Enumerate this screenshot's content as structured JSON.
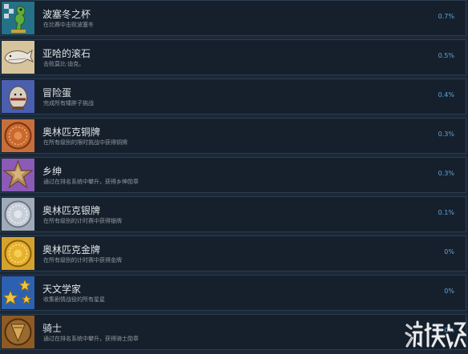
{
  "achievements": [
    {
      "name": "波塞冬之杯",
      "desc": "在比赛中击败波塞冬",
      "pct": "0.7%",
      "icon": "seahorse-trophy-icon"
    },
    {
      "name": "亚哈的滚石",
      "desc": "击败莫比·迪克。",
      "pct": "0.5%",
      "icon": "whale-icon"
    },
    {
      "name": "冒险蛋",
      "desc": "完成所有矮胖子挑战",
      "pct": "0.4%",
      "icon": "egg-icon"
    },
    {
      "name": "奥林匹克铜牌",
      "desc": "在所有级别的限时挑战中获得铜牌",
      "pct": "0.3%",
      "icon": "bronze-medal-icon"
    },
    {
      "name": "乡绅",
      "desc": "通过在排名系统中攀升，获得乡绅勋章",
      "pct": "0.3%",
      "icon": "star-badge-icon"
    },
    {
      "name": "奥林匹克银牌",
      "desc": "在所有级别的计时赛中获得银牌",
      "pct": "0.1%",
      "icon": "silver-medal-icon"
    },
    {
      "name": "奥林匹克金牌",
      "desc": "在所有级别的计时赛中获得金牌",
      "pct": "0%",
      "icon": "gold-medal-icon"
    },
    {
      "name": "天文学家",
      "desc": "收集剧情战役的所有星星",
      "pct": "0%",
      "icon": "stars-icon"
    },
    {
      "name": "骑士",
      "desc": "通过在排名系统中攀升，获得骑士勋章",
      "pct": "0%",
      "icon": "knight-badge-icon"
    }
  ],
  "watermark": {
    "logo": "游侠网",
    "brand_color": "#ffffff"
  },
  "colors": {
    "background": "#1b2838",
    "row_background": "#16202d",
    "title": "#dfe3e6",
    "description": "#8f98a0",
    "percent": "#5ea6d8"
  }
}
